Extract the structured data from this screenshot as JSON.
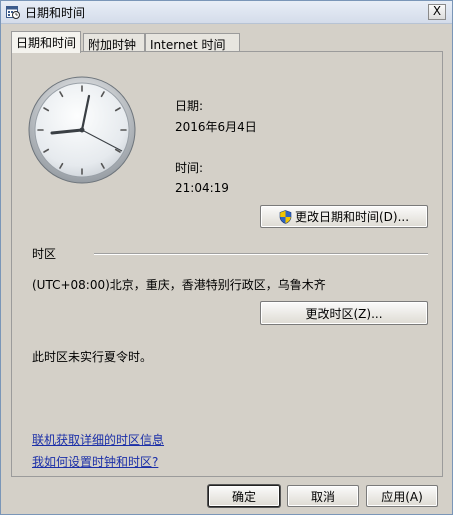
{
  "window": {
    "title": "日期和时间",
    "close_label": "X"
  },
  "tabs": [
    {
      "label": "日期和时间",
      "active": true
    },
    {
      "label": "附加时钟",
      "active": false
    },
    {
      "label": "Internet 时间",
      "active": false
    }
  ],
  "datetime": {
    "date_label": "日期:",
    "date_value": "2016年6月4日",
    "time_label": "时间:",
    "time_value": "21:04:19",
    "change_button": "更改日期和时间(D)..."
  },
  "timezone": {
    "section_label": "时区",
    "value": "(UTC+08:00)北京，重庆，香港特别行政区，乌鲁木齐",
    "change_button": "更改时区(Z)...",
    "dst_note": "此时区未实行夏令时。"
  },
  "links": {
    "more_info": "联机获取详细的时区信息",
    "how_to": "我如何设置时钟和时区?"
  },
  "footer": {
    "ok": "确定",
    "cancel": "取消",
    "apply": "应用(A)"
  }
}
